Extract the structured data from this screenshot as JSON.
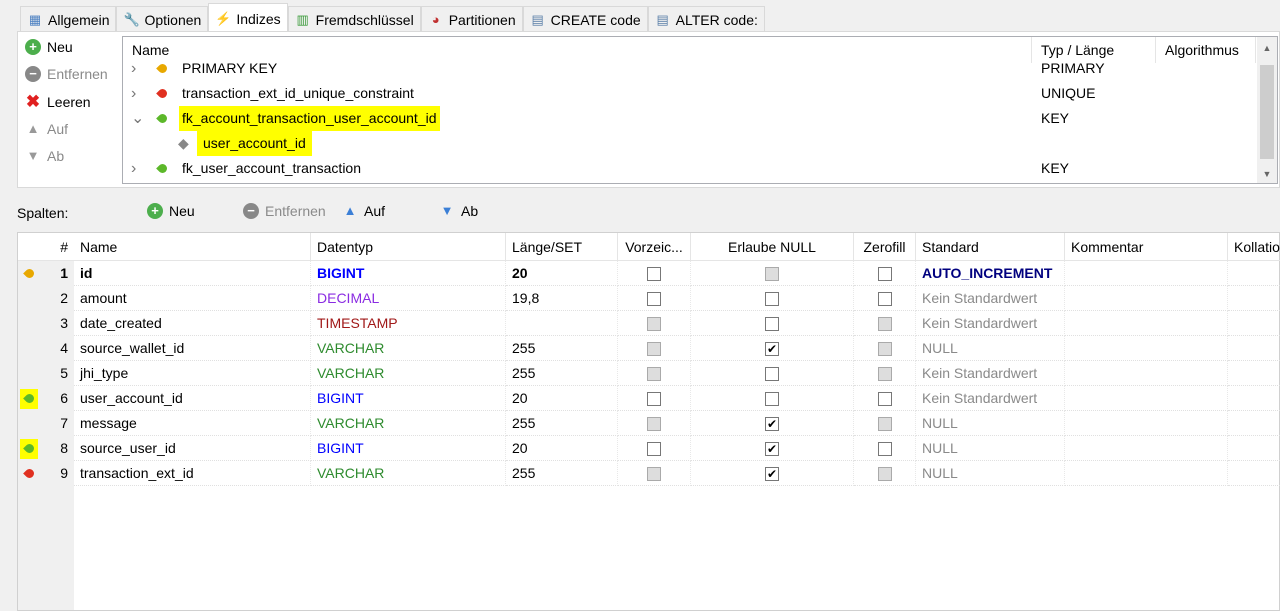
{
  "tabs": [
    {
      "label": "Allgemein",
      "icon": "table-icon"
    },
    {
      "label": "Optionen",
      "icon": "wrench-icon"
    },
    {
      "label": "Indizes",
      "icon": "lightning-icon",
      "active": true
    },
    {
      "label": "Fremdschlüssel",
      "icon": "foreign-key-icon"
    },
    {
      "label": "Partitionen",
      "icon": "pie-icon"
    },
    {
      "label": "CREATE code",
      "icon": "script-icon"
    },
    {
      "label": "ALTER code:",
      "icon": "script-icon"
    }
  ],
  "index_buttons": {
    "new": "Neu",
    "remove": "Entfernen",
    "clear": "Leeren",
    "up": "Auf",
    "down": "Ab"
  },
  "index_tree": {
    "headers": {
      "name": "Name",
      "type": "Typ / Länge",
      "algo": "Algorithmus"
    },
    "rows": [
      {
        "name": "PRIMARY KEY",
        "type": "PRIMARY",
        "key_color": "#e8a800",
        "expanded": false
      },
      {
        "name": "transaction_ext_id_unique_constraint",
        "type": "UNIQUE",
        "key_color": "#e03020",
        "expanded": false
      },
      {
        "name": "fk_account_transaction_user_account_id",
        "type": "KEY",
        "key_color": "#5cb82a",
        "expanded": true,
        "highlight": true
      },
      {
        "name": "user_account_id",
        "type": "",
        "child": true,
        "highlight": true
      },
      {
        "name": "fk_user_account_transaction",
        "type": "KEY",
        "key_color": "#5cb82a",
        "expanded": false
      }
    ]
  },
  "columns_toolbar": {
    "label": "Spalten:",
    "new": "Neu",
    "remove": "Entfernen",
    "up": "Auf",
    "down": "Ab"
  },
  "columns_table": {
    "headers": [
      "#",
      "Name",
      "Datentyp",
      "Länge/SET",
      "Vorzeic...",
      "Erlaube NULL",
      "Zerofill",
      "Standard",
      "Kommentar",
      "Kollation"
    ],
    "rows": [
      {
        "num": "1",
        "name": "id",
        "type": "BIGINT",
        "type_color": "#0000ff",
        "len": "20",
        "unsigned": "empty",
        "null": "disabled",
        "zerofill": "empty",
        "default": "AUTO_INCREMENT",
        "bold": true,
        "key_color": "#e8a800"
      },
      {
        "num": "2",
        "name": "amount",
        "type": "DECIMAL",
        "type_color": "#8a2be2",
        "len": "19,8",
        "unsigned": "empty",
        "null": "empty",
        "zerofill": "empty",
        "default": "Kein Standardwert"
      },
      {
        "num": "3",
        "name": "date_created",
        "type": "TIMESTAMP",
        "type_color": "#a01818",
        "len": "",
        "unsigned": "disabled",
        "null": "empty",
        "zerofill": "disabled",
        "default": "Kein Standardwert"
      },
      {
        "num": "4",
        "name": "source_wallet_id",
        "type": "VARCHAR",
        "type_color": "#2e8b2e",
        "len": "255",
        "unsigned": "disabled",
        "null": "checked",
        "zerofill": "disabled",
        "default": "NULL"
      },
      {
        "num": "5",
        "name": "jhi_type",
        "type": "VARCHAR",
        "type_color": "#2e8b2e",
        "len": "255",
        "unsigned": "disabled",
        "null": "empty",
        "zerofill": "disabled",
        "default": "Kein Standardwert"
      },
      {
        "num": "6",
        "name": "user_account_id",
        "type": "BIGINT",
        "type_color": "#0000ff",
        "len": "20",
        "unsigned": "empty",
        "null": "empty",
        "zerofill": "empty",
        "default": "Kein Standardwert",
        "key_color": "#5cb82a",
        "highlight": true
      },
      {
        "num": "7",
        "name": "message",
        "type": "VARCHAR",
        "type_color": "#2e8b2e",
        "len": "255",
        "unsigned": "disabled",
        "null": "checked",
        "zerofill": "disabled",
        "default": "NULL"
      },
      {
        "num": "8",
        "name": "source_user_id",
        "type": "BIGINT",
        "type_color": "#0000ff",
        "len": "20",
        "unsigned": "empty",
        "null": "checked",
        "zerofill": "empty",
        "default": "NULL",
        "key_color": "#5cb82a",
        "highlight": true
      },
      {
        "num": "9",
        "name": "transaction_ext_id",
        "type": "VARCHAR",
        "type_color": "#2e8b2e",
        "len": "255",
        "unsigned": "disabled",
        "null": "checked",
        "zerofill": "disabled",
        "default": "NULL",
        "key_color": "#e03020"
      }
    ]
  }
}
